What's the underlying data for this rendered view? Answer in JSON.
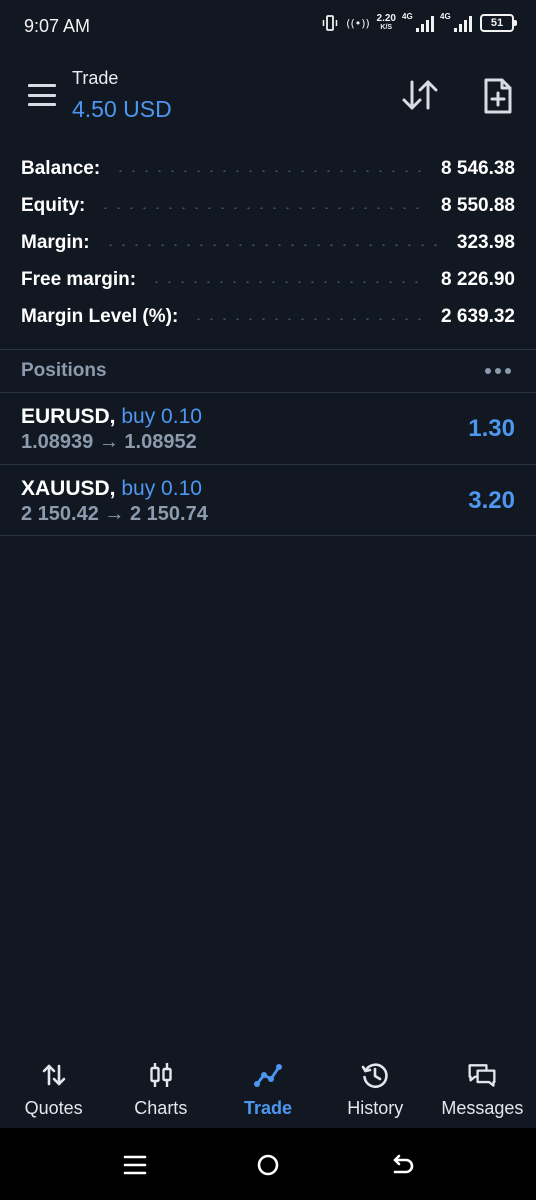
{
  "status_bar": {
    "time": "9:07 AM",
    "vibrate_icon": "vibrate-icon",
    "hotspot_icon": "hotspot-icon",
    "net_speed": "2.20",
    "net_speed_unit": "K/S",
    "signal_1_label": "4G",
    "signal_2_label": "4G",
    "battery": "51"
  },
  "header": {
    "title": "Trade",
    "subtitle": "4.50 USD",
    "menu_icon": "menu-icon",
    "sort_icon": "sort-arrows-icon",
    "new_order_icon": "new-document-icon"
  },
  "summary": [
    {
      "label": "Balance:",
      "value": "8 546.38"
    },
    {
      "label": "Equity:",
      "value": "8 550.88"
    },
    {
      "label": "Margin:",
      "value": "323.98"
    },
    {
      "label": "Free margin:",
      "value": "8 226.90"
    },
    {
      "label": "Margin Level (%):",
      "value": "2 639.32"
    }
  ],
  "positions": {
    "title": "Positions",
    "items": [
      {
        "symbol": "EURUSD,",
        "side": "buy 0.10",
        "open_price": "1.08939",
        "arrow": "→",
        "current_price": "1.08952",
        "profit": "1.30"
      },
      {
        "symbol": "XAUUSD,",
        "side": "buy 0.10",
        "open_price": "2 150.42",
        "arrow": "→",
        "current_price": "2 150.74",
        "profit": "3.20"
      }
    ]
  },
  "bottom_nav": {
    "items": [
      {
        "label": "Quotes",
        "icon": "quotes-arrows-icon"
      },
      {
        "label": "Charts",
        "icon": "candlestick-icon"
      },
      {
        "label": "Trade",
        "icon": "trade-line-icon"
      },
      {
        "label": "History",
        "icon": "history-clock-icon"
      },
      {
        "label": "Messages",
        "icon": "messages-bubbles-icon"
      }
    ],
    "active": "Trade"
  },
  "colors": {
    "background": "#121821",
    "accent": "#4d97f0",
    "muted_text": "#8b9aad",
    "divider": "#2c3643"
  }
}
